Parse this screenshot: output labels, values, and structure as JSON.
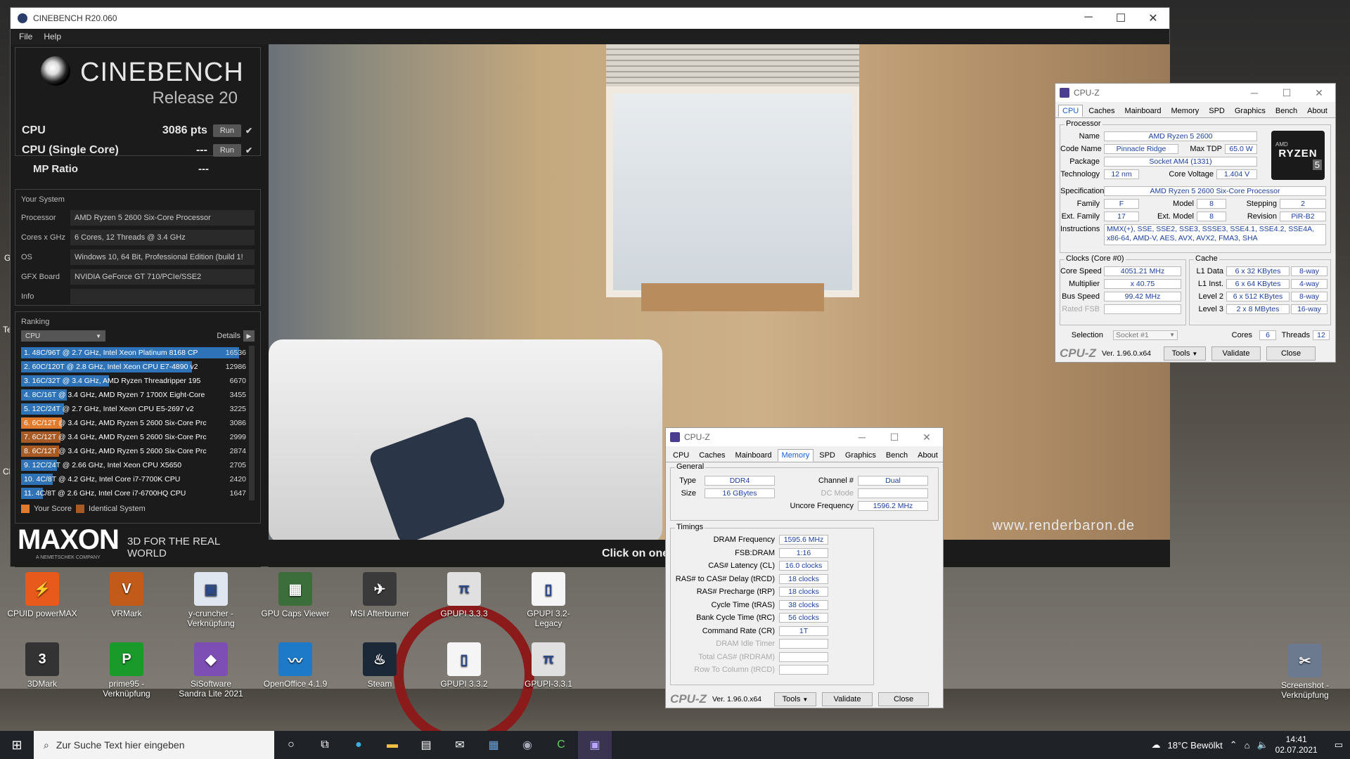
{
  "cinebench": {
    "title": "CINEBENCH R20.060",
    "menu": [
      "File",
      "Help"
    ],
    "logo_title": "CINEBENCH",
    "logo_sub": "Release 20",
    "cpu_label": "CPU",
    "cpu_score": "3086 pts",
    "single_label": "CPU (Single Core)",
    "single_score": "---",
    "mp_label": "MP Ratio",
    "mp_score": "---",
    "run_label": "Run",
    "your_system": "Your System",
    "system": [
      {
        "k": "Processor",
        "v": "AMD Ryzen 5 2600 Six-Core Processor"
      },
      {
        "k": "Cores x GHz",
        "v": "6 Cores, 12 Threads @ 3.4 GHz"
      },
      {
        "k": "OS",
        "v": "Windows 10, 64 Bit, Professional Edition (build 1!"
      },
      {
        "k": "GFX Board",
        "v": "NVIDIA GeForce GT 710/PCIe/SSE2"
      },
      {
        "k": "Info",
        "v": ""
      }
    ],
    "ranking_label": "Ranking",
    "ranking_select": "CPU",
    "details_label": "Details",
    "ranking": [
      {
        "t": "1. 48C/96T @ 2.7 GHz, Intel Xeon Platinum 8168 CP",
        "s": "16536",
        "frac": 1.0,
        "kind": "other"
      },
      {
        "t": "2. 60C/120T @ 2.8 GHz, Intel Xeon CPU E7-4890 v2",
        "s": "12986",
        "frac": 0.785,
        "kind": "other"
      },
      {
        "t": "3. 16C/32T @ 3.4 GHz, AMD Ryzen Threadripper 195",
        "s": "6670",
        "frac": 0.403,
        "kind": "other"
      },
      {
        "t": "4. 8C/16T @ 3.4 GHz, AMD Ryzen 7 1700X Eight-Core",
        "s": "3455",
        "frac": 0.209,
        "kind": "other"
      },
      {
        "t": "5. 12C/24T @ 2.7 GHz, Intel Xeon CPU E5-2697 v2",
        "s": "3225",
        "frac": 0.195,
        "kind": "other"
      },
      {
        "t": "6. 6C/12T @ 3.4 GHz, AMD Ryzen 5 2600 Six-Core Prc",
        "s": "3086",
        "frac": 0.187,
        "kind": "yours"
      },
      {
        "t": "7. 6C/12T @ 3.4 GHz, AMD Ryzen 5 2600 Six-Core Prc",
        "s": "2999",
        "frac": 0.181,
        "kind": "identical"
      },
      {
        "t": "8. 6C/12T @ 3.4 GHz, AMD Ryzen 5 2600 Six-Core Prc",
        "s": "2874",
        "frac": 0.174,
        "kind": "identical"
      },
      {
        "t": "9. 12C/24T @ 2.66 GHz, Intel Xeon CPU X5650",
        "s": "2705",
        "frac": 0.164,
        "kind": "other"
      },
      {
        "t": "10. 4C/8T @ 4.2 GHz, Intel Core i7-7700K CPU",
        "s": "2420",
        "frac": 0.146,
        "kind": "other"
      },
      {
        "t": "11. 4C/8T @ 2.6 GHz, Intel Core i7-6700HQ CPU",
        "s": "1647",
        "frac": 0.1,
        "kind": "other"
      }
    ],
    "legend_yours": "Your Score",
    "legend_identical": "Identical System",
    "maxon": "MAXON",
    "maxon_sub": "A NEMETSCHEK COMPANY",
    "tagline": "3D FOR THE REAL WORLD",
    "watermark": "www.renderbaron.de",
    "status": "Click on one"
  },
  "cpuz_main": {
    "title": "CPU-Z",
    "tabs": [
      "CPU",
      "Caches",
      "Mainboard",
      "Memory",
      "SPD",
      "Graphics",
      "Bench",
      "About"
    ],
    "processor_legend": "Processor",
    "name_l": "Name",
    "name": "AMD Ryzen 5 2600",
    "codename_l": "Code Name",
    "codename": "Pinnacle Ridge",
    "tdp_l": "Max TDP",
    "tdp": "65.0 W",
    "package_l": "Package",
    "package": "Socket AM4 (1331)",
    "tech_l": "Technology",
    "tech": "12 nm",
    "voltage_l": "Core Voltage",
    "voltage": "1.404 V",
    "spec_l": "Specification",
    "spec": "AMD Ryzen 5 2600 Six-Core Processor",
    "family_l": "Family",
    "family": "F",
    "model_l": "Model",
    "model": "8",
    "stepping_l": "Stepping",
    "stepping": "2",
    "extfamily_l": "Ext. Family",
    "extfamily": "17",
    "extmodel_l": "Ext. Model",
    "extmodel": "8",
    "revision_l": "Revision",
    "revision": "PiR-B2",
    "instr_l": "Instructions",
    "instr": "MMX(+), SSE, SSE2, SSE3, SSSE3, SSE4.1, SSE4.2, SSE4A, x86-64, AMD-V, AES, AVX, AVX2, FMA3, SHA",
    "clocks_legend": "Clocks (Core #0)",
    "corespeed_l": "Core Speed",
    "corespeed": "4051.21 MHz",
    "mult_l": "Multiplier",
    "mult": "x 40.75",
    "bus_l": "Bus Speed",
    "bus": "99.42 MHz",
    "fsb_l": "Rated FSB",
    "cache_legend": "Cache",
    "l1d_l": "L1 Data",
    "l1d": "6 x 32 KBytes",
    "l1d_w": "8-way",
    "l1i_l": "L1 Inst.",
    "l1i": "6 x 64 KBytes",
    "l1i_w": "4-way",
    "l2_l": "Level 2",
    "l2": "6 x 512 KBytes",
    "l2_w": "8-way",
    "l3_l": "Level 3",
    "l3": "2 x 8 MBytes",
    "l3_w": "16-way",
    "selection_l": "Selection",
    "selection": "Socket #1",
    "cores_l": "Cores",
    "cores": "6",
    "threads_l": "Threads",
    "threads": "12",
    "brand": "CPU-Z",
    "version": "Ver. 1.96.0.x64",
    "tools": "Tools",
    "validate": "Validate",
    "close": "Close",
    "badge_amd": "AMD",
    "badge_ryzen": "RYZEN",
    "badge_num": "5"
  },
  "cpuz_mem": {
    "title": "CPU-Z",
    "tabs": [
      "CPU",
      "Caches",
      "Mainboard",
      "Memory",
      "SPD",
      "Graphics",
      "Bench",
      "About"
    ],
    "general_legend": "General",
    "type_l": "Type",
    "type": "DDR4",
    "size_l": "Size",
    "size": "16 GBytes",
    "channel_l": "Channel #",
    "channel": "Dual",
    "dcmode_l": "DC Mode",
    "uncore_l": "Uncore Frequency",
    "uncore": "1596.2 MHz",
    "timings_legend": "Timings",
    "timings": [
      {
        "k": "DRAM Frequency",
        "v": "1595.6 MHz",
        "dim": false
      },
      {
        "k": "FSB:DRAM",
        "v": "1:16",
        "dim": false
      },
      {
        "k": "CAS# Latency (CL)",
        "v": "16.0 clocks",
        "dim": false
      },
      {
        "k": "RAS# to CAS# Delay (tRCD)",
        "v": "18 clocks",
        "dim": false
      },
      {
        "k": "RAS# Precharge (tRP)",
        "v": "18 clocks",
        "dim": false
      },
      {
        "k": "Cycle Time (tRAS)",
        "v": "38 clocks",
        "dim": false
      },
      {
        "k": "Bank Cycle Time (tRC)",
        "v": "56 clocks",
        "dim": false
      },
      {
        "k": "Command Rate (CR)",
        "v": "1T",
        "dim": false
      },
      {
        "k": "DRAM Idle Timer",
        "v": "",
        "dim": true
      },
      {
        "k": "Total CAS# (tRDRAM)",
        "v": "",
        "dim": true
      },
      {
        "k": "Row To Column (tRCD)",
        "v": "",
        "dim": true
      }
    ],
    "brand": "CPU-Z",
    "version": "Ver. 1.96.0.x64",
    "tools": "Tools",
    "validate": "Validate",
    "close": "Close"
  },
  "desktop": {
    "icons": [
      {
        "label": "CPUID powerMAX",
        "color": "#e8591c",
        "glyph": "⚡"
      },
      {
        "label": "VRMark",
        "color": "#c25a1a",
        "glyph": "V"
      },
      {
        "label": "y-cruncher - Verknüpfung",
        "color": "#dfe6ef",
        "glyph": "▣"
      },
      {
        "label": "GPU Caps Viewer",
        "color": "#3b6e3b",
        "glyph": "▦"
      },
      {
        "label": "MSI Afterburner",
        "color": "#3a3a3a",
        "glyph": "✈"
      },
      {
        "label": "GPUPI 3.3.3",
        "color": "#e0e0e0",
        "glyph": "π"
      },
      {
        "label": "GPUPI 3.2- Legacy",
        "color": "#f5f5f5",
        "glyph": "▯"
      },
      {
        "label": "3DMark",
        "color": "#333333",
        "glyph": "3"
      },
      {
        "label": "prime95 - Verknüpfung",
        "color": "#1a9a2a",
        "glyph": "P"
      },
      {
        "label": "SiSoftware Sandra Lite 2021",
        "color": "#7d4fb5",
        "glyph": "◆"
      },
      {
        "label": "OpenOffice 4.1.9",
        "color": "#1d7ac9",
        "glyph": "〰"
      },
      {
        "label": "Steam",
        "color": "#1b2838",
        "glyph": "♨"
      },
      {
        "label": "GPUPI 3.3.2",
        "color": "#f5f5f5",
        "glyph": "▯"
      },
      {
        "label": "GPUPI-3.3.1",
        "color": "#e0e0e0",
        "glyph": "π"
      },
      {
        "label": "Screenshot - Verknüpfung",
        "color": "#6c7a90",
        "glyph": "✂"
      }
    ],
    "edge_labels": [
      "G",
      "Te",
      "Ch"
    ]
  },
  "taskbar": {
    "search_placeholder": "Zur Suche Text hier eingeben",
    "weather": "18°C  Bewölkt",
    "time": "14:41",
    "date": "02.07.2021"
  }
}
